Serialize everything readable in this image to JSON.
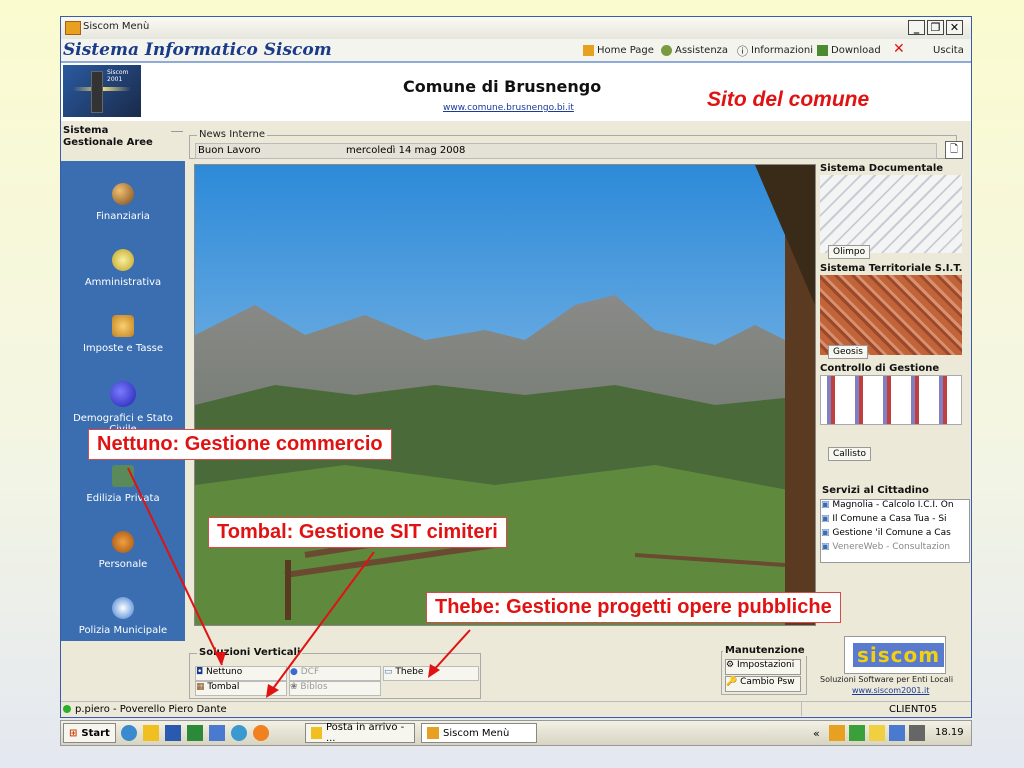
{
  "window": {
    "title": "Siscom Menù",
    "brand": "Sistema Informatico Siscom"
  },
  "toolbar": {
    "home": "Home Page",
    "assist": "Assistenza",
    "info": "Informazioni",
    "download": "Download",
    "exit": "Uscita"
  },
  "header": {
    "logo_text": "Siscom 2001",
    "municipality": "Comune di Brusnengo",
    "url": "www.comune.brusnengo.bi.it",
    "site_label": "Sito del comune"
  },
  "sidebar": {
    "section_title": "Sistema Gestionale Aree",
    "items": [
      {
        "label": "Finanziaria",
        "icon": "planet-icon"
      },
      {
        "label": "Amministrativa",
        "icon": "mail-icon"
      },
      {
        "label": "Imposte e Tasse",
        "icon": "scales-icon"
      },
      {
        "label": "Demografici e Stato Civile",
        "icon": "smiley-icon"
      },
      {
        "label": "Edilizia Privata",
        "icon": "building-icon"
      },
      {
        "label": "Personale",
        "icon": "people-icon"
      },
      {
        "label": "Polizia Municipale",
        "icon": "police-badge-icon"
      }
    ]
  },
  "news": {
    "legend": "News Interne",
    "text": "Buon Lavoro",
    "date": "mercoledì 14 mag 2008"
  },
  "right_panel": {
    "documentale": {
      "title": "Sistema Documentale",
      "button": "Olimpo"
    },
    "territoriale": {
      "title": "Sistema Territoriale S.I.T.",
      "button": "Geosis"
    },
    "controllo": {
      "title": "Controllo di Gestione",
      "button": "Callisto"
    },
    "servizi": {
      "title": "Servizi al Cittadino",
      "items": [
        "Magnolia - Calcolo I.C.I. On",
        "Il Comune a Casa Tua - Si",
        "Gestione 'il Comune a Cas",
        "VenereWeb - Consultazion"
      ]
    }
  },
  "verticali": {
    "title": "Soluzioni Verticali",
    "items": [
      "Nettuno",
      "DCF",
      "Thebe",
      "Tombal",
      "Biblos"
    ]
  },
  "manutenzione": {
    "title": "Manutenzione",
    "impostazioni": "Impostazioni",
    "cambio_psw": "Cambio Psw"
  },
  "siscom_logo": {
    "logo": "siscom",
    "caption": "Soluzioni Software per Enti Locali",
    "url": "www.siscom2001.it"
  },
  "status": {
    "user": "p.piero - Poverello Piero Dante",
    "client": "CLIENT05"
  },
  "taskbar": {
    "start": "Start",
    "task1": "Posta in arrivo - ...",
    "task2": "Siscom Menù",
    "chevron": "«",
    "clock": "18.19"
  },
  "callouts": {
    "nettuno": "Nettuno: Gestione commercio",
    "tombal": "Tombal: Gestione SIT cimiteri",
    "thebe": "Thebe: Gestione progetti opere pubbliche"
  },
  "colors": {
    "accent": "#1a3b8a",
    "sidebar": "#3a6eb0",
    "callout": "#e01212"
  }
}
